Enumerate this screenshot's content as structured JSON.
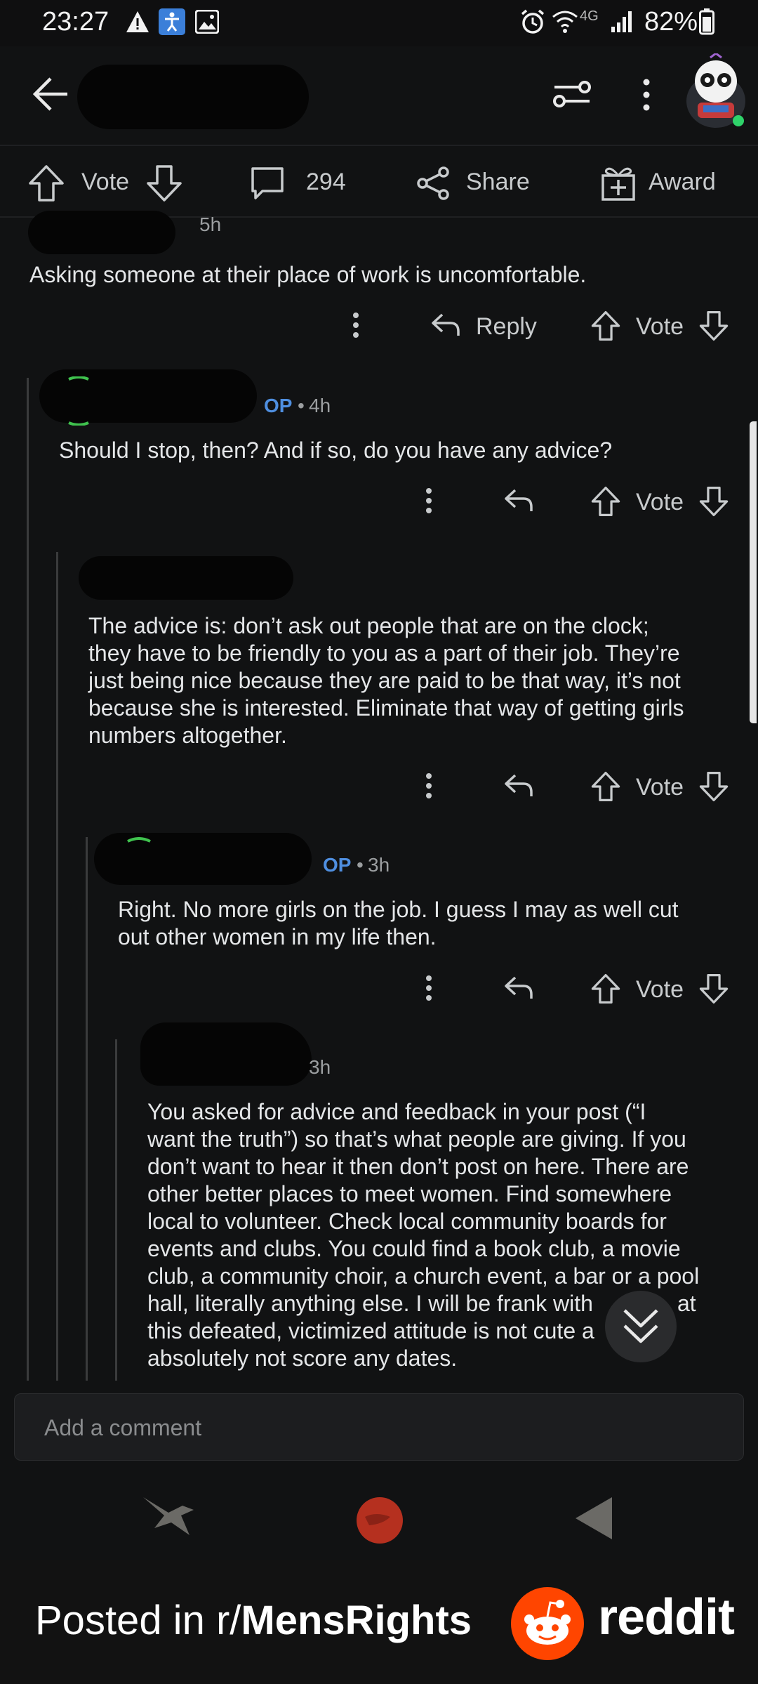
{
  "status_bar": {
    "time": "23:27",
    "network": "4G",
    "battery": "82%"
  },
  "action_bar": {
    "vote_label": "Vote",
    "comment_count": "294",
    "share_label": "Share",
    "award_label": "Award"
  },
  "comments": [
    {
      "time": "5h",
      "text": "Asking someone at their place of work is uncomfortable.",
      "reply_label": "Reply",
      "vote_label": "Vote"
    },
    {
      "badge": "OP",
      "time": "4h",
      "text": "Should I stop, then? And if so, do you have any advice?",
      "vote_label": "Vote"
    },
    {
      "lines": [
        "The advice is: don’t ask out people that are on the clock;",
        "they have to be friendly to you as a part of their job. They’re",
        "just being nice because they are paid to be that way, it’s not",
        "because she is interested. Eliminate that way of getting girls",
        "numbers altogether."
      ],
      "vote_label": "Vote"
    },
    {
      "badge": "OP",
      "time": "3h",
      "lines": [
        "Right. No more girls on the job. I guess I may as well cut",
        "out other women in my life then."
      ],
      "vote_label": "Vote"
    },
    {
      "time": "3h",
      "lines": [
        "You asked for advice and feedback in your post (“I",
        "want the truth”) so that’s what people are giving. If you",
        "don’t want to hear it then don’t post on here. There are",
        "other better places to meet women. Find somewhere",
        "local to volunteer. Check local community boards for",
        "events and clubs. You could find a book club, a movie",
        "club, a community choir, a church event, a bar or a pool",
        "hall, literally anything else. I will be frank with",
        "this defeated, victimized attitude is not cute a",
        "absolutely not score any dates."
      ],
      "line8_tail": "at"
    }
  ],
  "add_comment_placeholder": "Add a comment",
  "footer": {
    "posted_prefix": "Posted in r/",
    "subreddit": "MensRights",
    "brand": "reddit"
  },
  "colors": {
    "background": "#111213",
    "op_badge": "#4f8fe0",
    "reddit_orange": "#ff4500"
  }
}
